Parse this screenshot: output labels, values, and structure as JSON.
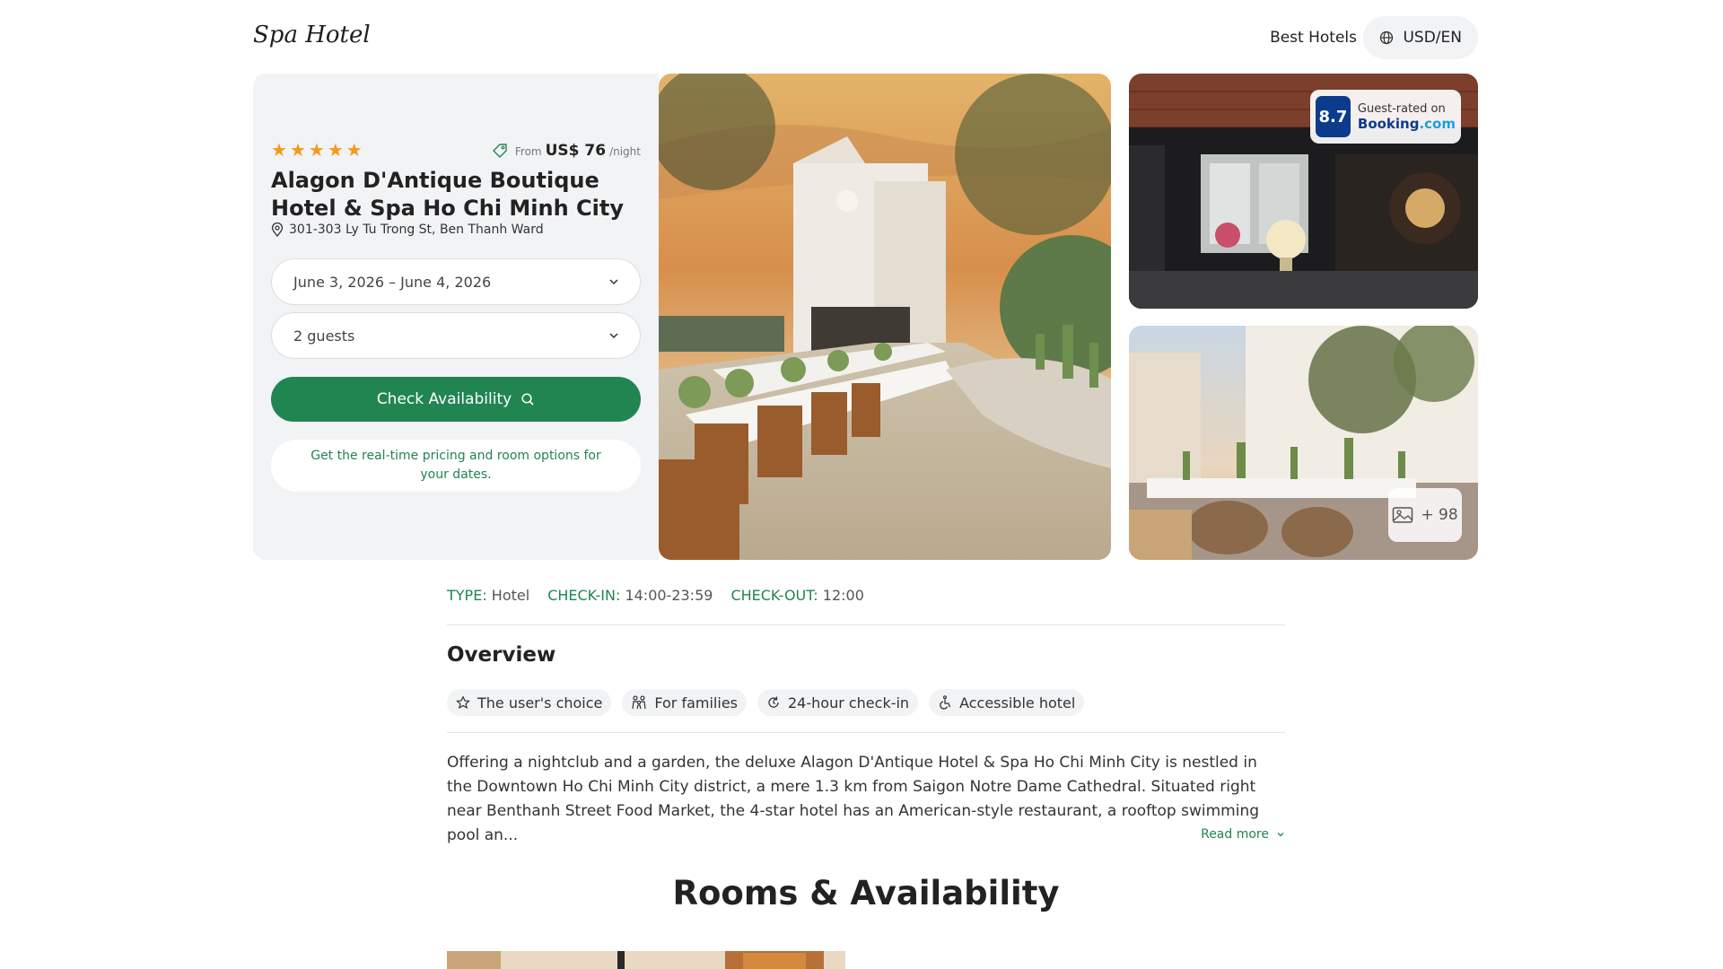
{
  "header": {
    "logo": "Spa Hotel",
    "nav_best_hotels": "Best Hotels",
    "currency_language": "USD/EN"
  },
  "hotel": {
    "stars": 5,
    "price_from_label": "From",
    "price_amount": "US$ 76",
    "price_unit": "/night",
    "name": "Alagon D'Antique Boutique Hotel & Spa Ho Chi Minh City",
    "address": "301-303 Ly Tu Trong St, Ben Thanh Ward"
  },
  "booking": {
    "dates_value": "June 3, 2026 – June 4, 2026",
    "guests_value": "2 guests",
    "check_button": "Check Availability",
    "note": "Get the real-time pricing and room options for your dates."
  },
  "gallery": {
    "rating_score": "8.7",
    "rating_label": "Guest-rated on",
    "rating_source_main": "Booking",
    "rating_source_suffix": ".com",
    "more_photos": "+ 98"
  },
  "facts": {
    "type_label": "TYPE",
    "type_value": "Hotel",
    "checkin_label": "CHECK-IN",
    "checkin_value": "14:00-23:59",
    "checkout_label": "CHECK-OUT",
    "checkout_value": "12:00"
  },
  "overview": {
    "title": "Overview",
    "chips": [
      "The user's choice",
      "For families",
      "24-hour check-in",
      "Accessible hotel"
    ],
    "description": "Offering a nightclub and a garden, the deluxe Alagon D'Antique Hotel & Spa Ho Chi Minh City is nestled in the Downtown Ho Chi Minh City district, a mere 1.3 km from Saigon Notre Dame Cathedral. Situated right near Benthanh Street Food Market, the 4-star hotel has an American-style restaurant, a rooftop swimming pool an...",
    "read_more": "Read more"
  },
  "rooms": {
    "title": "Rooms & Availability"
  },
  "colors": {
    "accent_green": "#218552",
    "star_orange": "#f39a1b",
    "booking_blue": "#0c3b8c",
    "panel_bg": "#f2f3f5"
  }
}
